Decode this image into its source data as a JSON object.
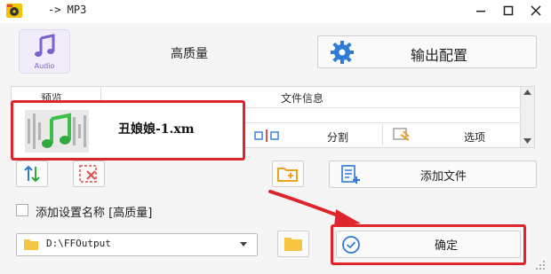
{
  "window": {
    "title": "-> MP3",
    "minimize_icon": "minimize-icon",
    "maximize_icon": "maximize-icon",
    "close_icon": "close-icon"
  },
  "format": {
    "tile_label": "Audio",
    "quality": "高质量"
  },
  "toolbar": {
    "config_label": "输出配置"
  },
  "file_list": {
    "columns": [
      "预览",
      "文件信息"
    ],
    "rows": [
      {
        "file_name": "丑娘娘-1.xm",
        "actions": [
          "分割",
          "选项"
        ]
      }
    ]
  },
  "actions": {
    "add_file_label": "添加文件"
  },
  "options": {
    "add_name_label": "添加设置名称 [高质量]",
    "add_name_checked": false
  },
  "output": {
    "path": "D:\\FFOutput"
  },
  "confirm": {
    "label": "确定"
  },
  "colors": {
    "highlight": "#e0242b",
    "accent_blue": "#2f7bd6",
    "accent_orange": "#f0a020",
    "accent_red": "#e05050"
  }
}
